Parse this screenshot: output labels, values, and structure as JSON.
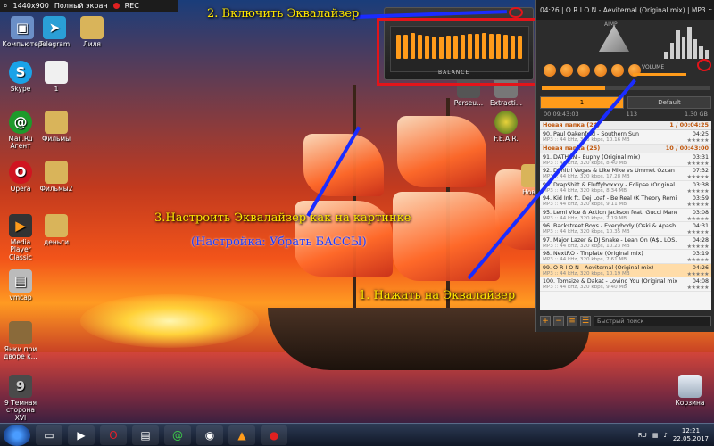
{
  "recorder": {
    "resolution": "1440x900",
    "mode": "Полный экран",
    "rec": "REC"
  },
  "desktop_icons": [
    "Компьютер",
    "Telegram",
    "Лиля",
    "Skype",
    "1",
    "Mail.Ru Агент",
    "Фильмы",
    "Opera",
    "Фильмы2",
    "Media Player Classic",
    "деньги",
    "vmcap",
    "Янки при дворе к...",
    "9 Темная сторона XVI",
    "Perseu...",
    "Extracti...",
    "F.E.A.R.",
    "Новая",
    "Корзина"
  ],
  "annotations": {
    "step2": "2. Включить Эквалайзер",
    "step3": "3.Настроить Эквалайзер как на картинке",
    "step3_note": "(Настройка: Убрать БАССЫ)",
    "step1": "1. Нажать на Эквалайзер"
  },
  "equalizer": {
    "balance_label": "BALANCE",
    "bands": [
      0.85,
      0.85,
      0.9,
      0.85,
      0.8,
      0.78,
      0.78,
      0.8,
      0.82,
      0.84,
      0.86,
      0.88,
      0.9,
      0.88,
      0.86,
      0.84,
      0.82,
      0.8
    ]
  },
  "player": {
    "now_playing": "04:26 | O R I O N - Aeviternal (Original mix) | MP3 :: 44 k",
    "logo": "AIMP",
    "volume_label": "VOLUME",
    "tabs": [
      "1",
      "Default"
    ],
    "summary": {
      "time": "00:09:43:03",
      "count": "113",
      "size": "1.30 GB"
    },
    "groups": [
      {
        "name": "Новая папка (24)",
        "info": "1 / 00:04:25"
      },
      {
        "name": "Новая папка (25)",
        "info": "10 / 00:43:00"
      }
    ],
    "tracks": [
      {
        "title": "90. Paul Oakenfold - Southern Sun",
        "meta": "MP3 :: 44 kHz, 320 kbps, 10.16 MB",
        "dur": "04:25",
        "stars": "★★★★★"
      },
      {
        "title": "91. DATHAN - Euphy (Original mix)",
        "meta": "MP3 :: 44 kHz, 320 kbps, 8.40 MB",
        "dur": "03:31",
        "stars": "★★★★★"
      },
      {
        "title": "92. Dimitri Vegas & Like Mike vs Ummet Ozcan - ...",
        "meta": "MP3 :: 44 kHz, 320 kbps, 17.28 MB",
        "dur": "07:32",
        "stars": "★★★★★"
      },
      {
        "title": "93. DrapShift & Fluffyboxxxy - Eclipse (Original mix)",
        "meta": "MP3 :: 44 kHz, 320 kbps, 8.34 MB",
        "dur": "03:38",
        "stars": "★★★★★"
      },
      {
        "title": "94. Kid Ink ft. Dej Loaf - Be Real (K Theory Remix)",
        "meta": "MP3 :: 44 kHz, 320 kbps, 9.11 MB",
        "dur": "03:59",
        "stars": "★★★★★"
      },
      {
        "title": "95. Lemi Vice & Action Jackson feat. Gucci Mane ...",
        "meta": "MP3 :: 44 kHz, 320 kbps, 7.19 MB",
        "dur": "03:08",
        "stars": "★★★★★"
      },
      {
        "title": "96. Backstreet Boys - Everybody (Oski & Apash...",
        "meta": "MP3 :: 44 kHz, 320 kbps, 10.35 MB",
        "dur": "04:31",
        "stars": "★★★★★"
      },
      {
        "title": "97. Major Lazer & DJ Snake - Lean On (A$L LOS...",
        "meta": "MP3 :: 44 kHz, 320 kbps, 10.23 MB",
        "dur": "04:28",
        "stars": "★★★★★"
      },
      {
        "title": "98. NextRO - Tinplate (Original mix)",
        "meta": "MP3 :: 44 kHz, 320 kbps, 7.61 MB",
        "dur": "03:19",
        "stars": "★★★★★"
      },
      {
        "title": "99. O R I O N - Aeviternal (Original mix)",
        "meta": "MP3 :: 44 kHz, 320 kbps, 10.19 MB",
        "dur": "04:26",
        "stars": "★★★★★"
      },
      {
        "title": "100. Tomsize & Dakat - Loving You (Original mix)",
        "meta": "MP3 :: 44 kHz, 320 kbps, 9.40 MB",
        "dur": "04:08",
        "stars": "★★★★★"
      }
    ],
    "search_placeholder": "Быстрый поиск"
  },
  "taskbar": {
    "lang": "RU",
    "time": "12:21",
    "date": "22.05.2017"
  }
}
